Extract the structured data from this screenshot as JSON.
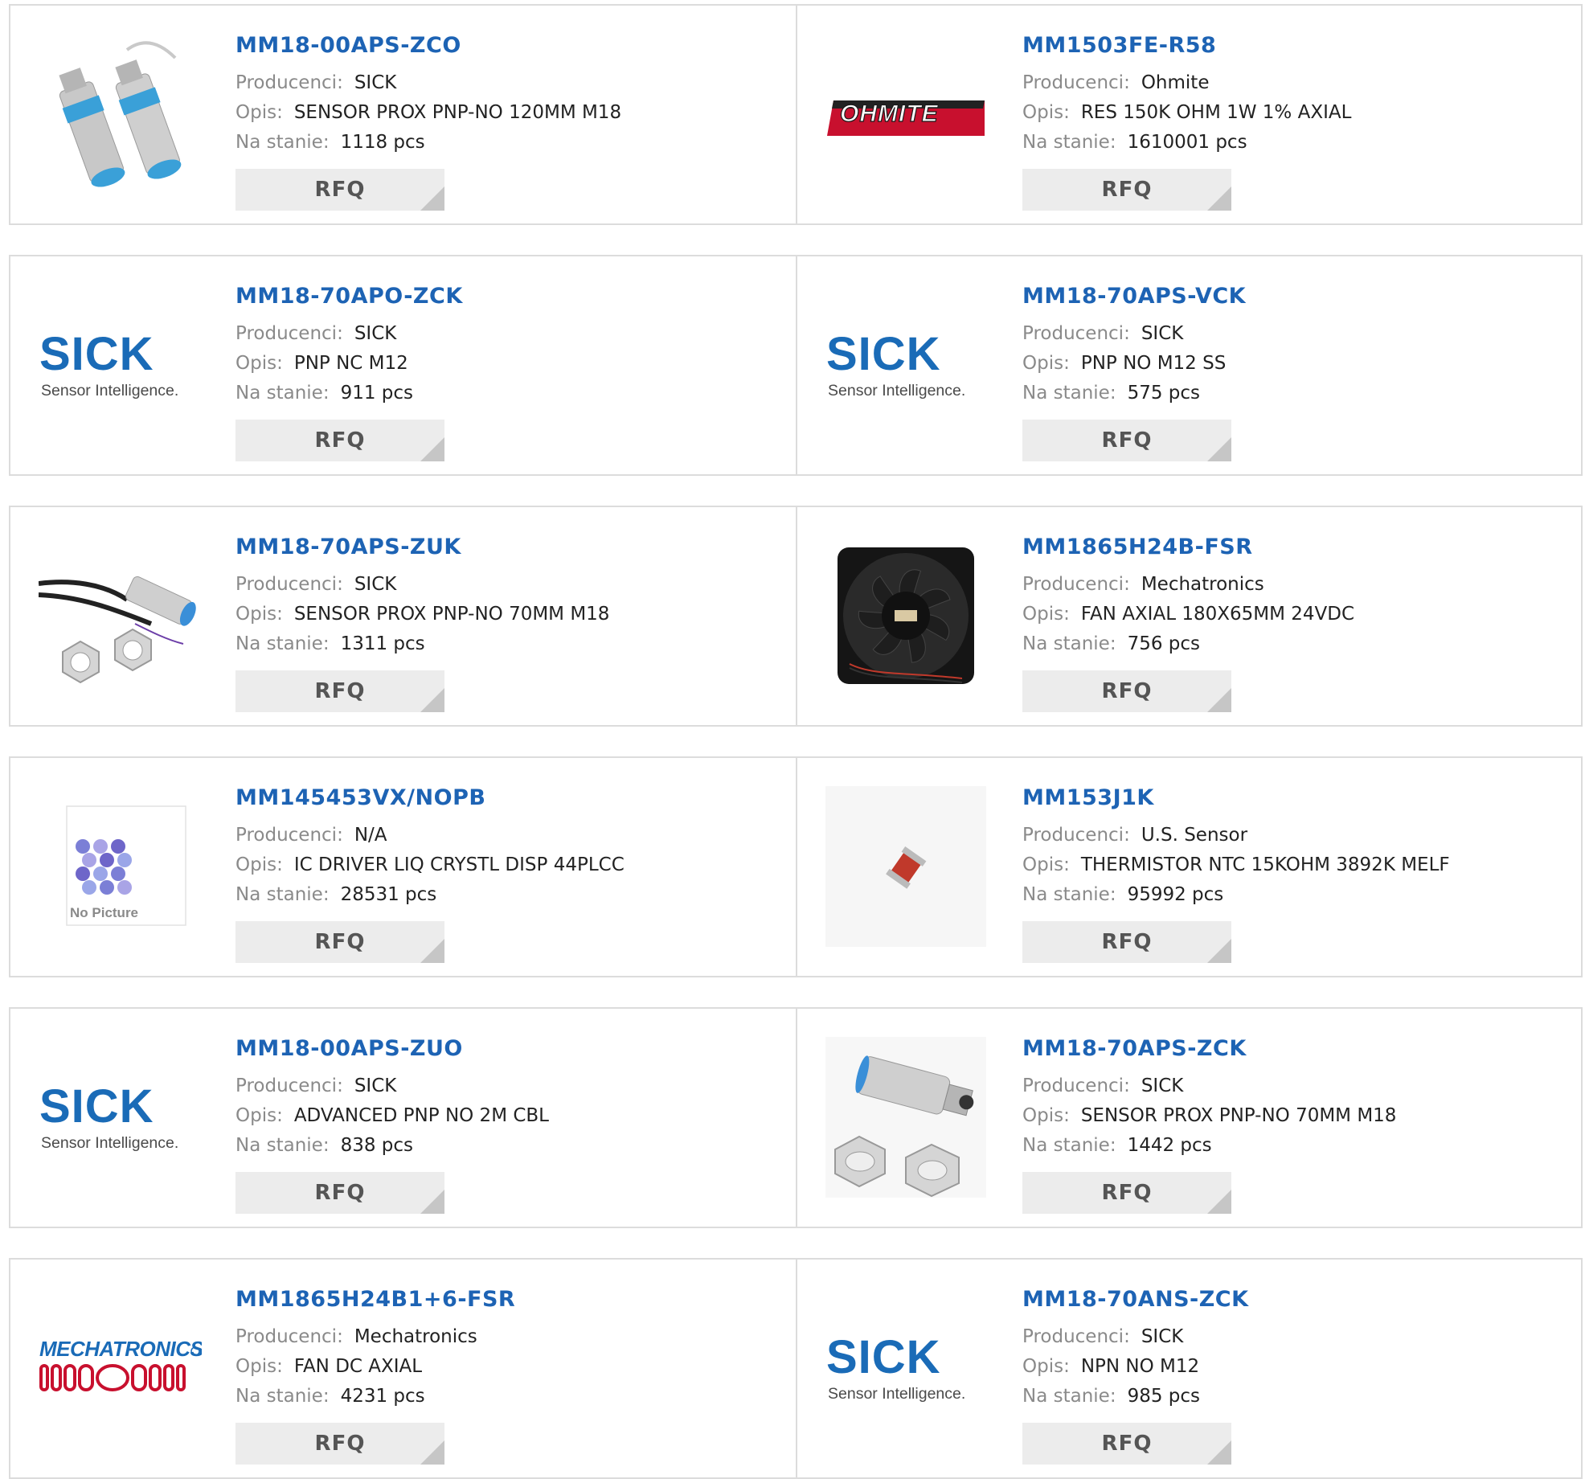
{
  "labels": {
    "manufacturer": "Producenci:",
    "description": "Opis:",
    "stock": "Na stanie:",
    "rfq": "RFQ",
    "no_picture": "No Picture",
    "sick_brand": "SICK",
    "sick_tagline": "Sensor Intelligence.",
    "ohmite_brand": "OHMITE",
    "mechatronics_brand": "MECHATRONICS"
  },
  "colors": {
    "title_blue": "#1d63b4",
    "label_grey": "#8a8a8a",
    "sick_blue": "#1a6bb7",
    "ohmite_red": "#c8102e",
    "mechatronics_red": "#c8102e",
    "button_bg": "#ececec"
  },
  "products": [
    {
      "part": "MM18-00APS-ZCO",
      "manufacturer": "SICK",
      "description": "SENSOR PROX PNP-NO 120MM M18",
      "stock": "1118 pcs",
      "image": "sensor-pair-icon"
    },
    {
      "part": "MM1503FE-R58",
      "manufacturer": "Ohmite",
      "description": "RES 150K OHM 1W 1% AXIAL",
      "stock": "1610001 pcs",
      "image": "ohmite-logo"
    },
    {
      "part": "MM18-70APO-ZCK",
      "manufacturer": "SICK",
      "description": "PNP NC M12",
      "stock": "911 pcs",
      "image": "sick-logo"
    },
    {
      "part": "MM18-70APS-VCK",
      "manufacturer": "SICK",
      "description": "PNP NO M12 SS",
      "stock": "575 pcs",
      "image": "sick-logo"
    },
    {
      "part": "MM18-70APS-ZUK",
      "manufacturer": "SICK",
      "description": "SENSOR PROX PNP-NO 70MM M18",
      "stock": "1311 pcs",
      "image": "cable-sensor-icon"
    },
    {
      "part": "MM1865H24B-FSR",
      "manufacturer": "Mechatronics",
      "description": "FAN AXIAL 180X65MM 24VDC",
      "stock": "756 pcs",
      "image": "fan-icon"
    },
    {
      "part": "MM145453VX/NOPB",
      "manufacturer": "N/A",
      "description": "IC DRIVER LIQ CRYSTL DISP 44PLCC",
      "stock": "28531 pcs",
      "image": "no-picture"
    },
    {
      "part": "MM153J1K",
      "manufacturer": "U.S. Sensor",
      "description": "THERMISTOR NTC 15KOHM 3892K MELF",
      "stock": "95992 pcs",
      "image": "thermistor-icon"
    },
    {
      "part": "MM18-00APS-ZUO",
      "manufacturer": "SICK",
      "description": "ADVANCED PNP NO 2M CBL",
      "stock": "838 pcs",
      "image": "sick-logo"
    },
    {
      "part": "MM18-70APS-ZCK",
      "manufacturer": "SICK",
      "description": "SENSOR PROX PNP-NO 70MM M18",
      "stock": "1442 pcs",
      "image": "sensor-nuts-icon"
    },
    {
      "part": "MM1865H24B1+6-FSR",
      "manufacturer": "Mechatronics",
      "description": "FAN DC AXIAL",
      "stock": "4231 pcs",
      "image": "mechatronics-logo"
    },
    {
      "part": "MM18-70ANS-ZCK",
      "manufacturer": "SICK",
      "description": "NPN NO M12",
      "stock": "985 pcs",
      "image": "sick-logo"
    }
  ]
}
